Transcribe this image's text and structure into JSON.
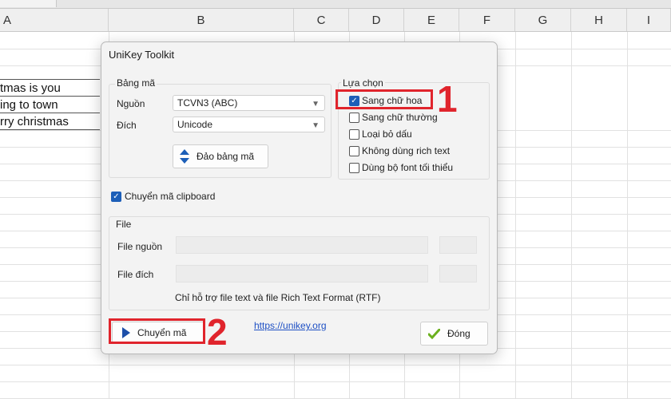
{
  "spreadsheet": {
    "columns": [
      "A",
      "B",
      "C",
      "D",
      "E",
      "F",
      "G",
      "H",
      "I"
    ],
    "cells": [
      "tmas is you",
      "ing to town",
      "rry christmas"
    ]
  },
  "dialog": {
    "title": "UniKey Toolkit",
    "encoding": {
      "group_label": "Bảng mã",
      "source_label": "Nguồn",
      "source_value": "TCVN3 (ABC)",
      "target_label": "Đích",
      "target_value": "Unicode",
      "swap_label": "Đảo bảng mã"
    },
    "options": {
      "group_label": "Lựa chọn",
      "items": [
        {
          "label": "Sang chữ hoa",
          "checked": true
        },
        {
          "label": "Sang chữ thường",
          "checked": false
        },
        {
          "label": "Loại bỏ dấu",
          "checked": false
        },
        {
          "label": "Không dùng rich text",
          "checked": false
        },
        {
          "label": "Dùng bộ font tối thiểu",
          "checked": false
        }
      ]
    },
    "clipboard": {
      "label": "Chuyển mã clipboard",
      "checked": true
    },
    "file": {
      "group_label": "File",
      "source_label": "File nguồn",
      "target_label": "File đích",
      "note": "Chỉ hỗ trợ file text và file Rich Text Format (RTF)"
    },
    "convert_label": "Chuyển mã",
    "link": "https://unikey.org",
    "close_label": "Đóng"
  },
  "annotations": {
    "marker1": "1",
    "marker2": "2",
    "color": "#e0242c"
  }
}
